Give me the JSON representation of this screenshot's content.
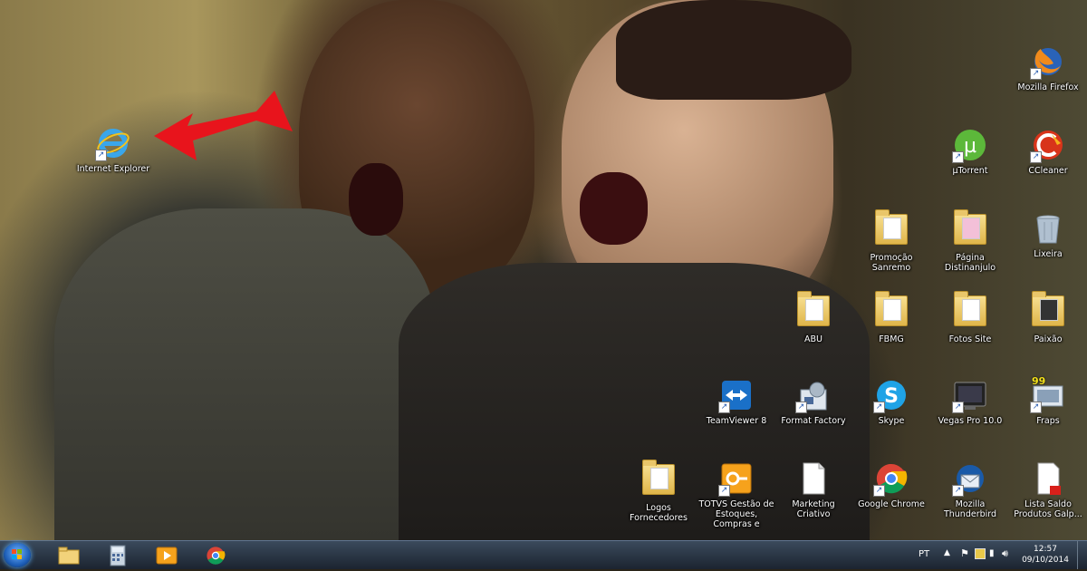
{
  "desktop": {
    "icons": [
      {
        "label": "Internet Explorer",
        "icon": "ie-icon"
      },
      {
        "label": "Mozilla Firefox",
        "icon": "firefox-icon"
      },
      {
        "label": "µTorrent",
        "icon": "utorrent-icon"
      },
      {
        "label": "CCleaner",
        "icon": "ccleaner-icon"
      },
      {
        "label": "Promoção Sanremo",
        "icon": "folder-icon"
      },
      {
        "label": "Página Distinanjulo",
        "icon": "folder-icon"
      },
      {
        "label": "Lixeira",
        "icon": "recycle-bin-icon"
      },
      {
        "label": "ABU",
        "icon": "folder-icon"
      },
      {
        "label": "FBMG",
        "icon": "folder-icon"
      },
      {
        "label": "Fotos Site",
        "icon": "folder-icon"
      },
      {
        "label": "Paixão",
        "icon": "folder-icon"
      },
      {
        "label": "TeamViewer 8",
        "icon": "teamviewer-icon"
      },
      {
        "label": "Format Factory",
        "icon": "format-factory-icon"
      },
      {
        "label": "Skype",
        "icon": "skype-icon"
      },
      {
        "label": "Vegas Pro 10.0",
        "icon": "vegas-icon"
      },
      {
        "label": "Fraps",
        "icon": "fraps-icon"
      },
      {
        "label": "Logos Fornecedores",
        "icon": "folder-icon"
      },
      {
        "label": "TOTVS Gestão de Estoques, Compras e",
        "icon": "totvs-icon"
      },
      {
        "label": "Marketing Criativo",
        "icon": "document-icon"
      },
      {
        "label": "Google Chrome",
        "icon": "chrome-icon"
      },
      {
        "label": "Mozilla Thunderbird",
        "icon": "thunderbird-icon"
      },
      {
        "label": "Lista Saldo Produtos Galp...",
        "icon": "pdf-icon"
      }
    ],
    "fraps_badge": "99"
  },
  "taskbar": {
    "pinned": [
      "windows-explorer-icon",
      "calculator-icon",
      "media-player-icon",
      "chrome-icon"
    ],
    "tray": {
      "language": "PT",
      "time": "12:57",
      "date": "09/10/2014"
    }
  },
  "colors": {
    "arrow": "#e8141c",
    "taskbar": "#1c2430"
  }
}
